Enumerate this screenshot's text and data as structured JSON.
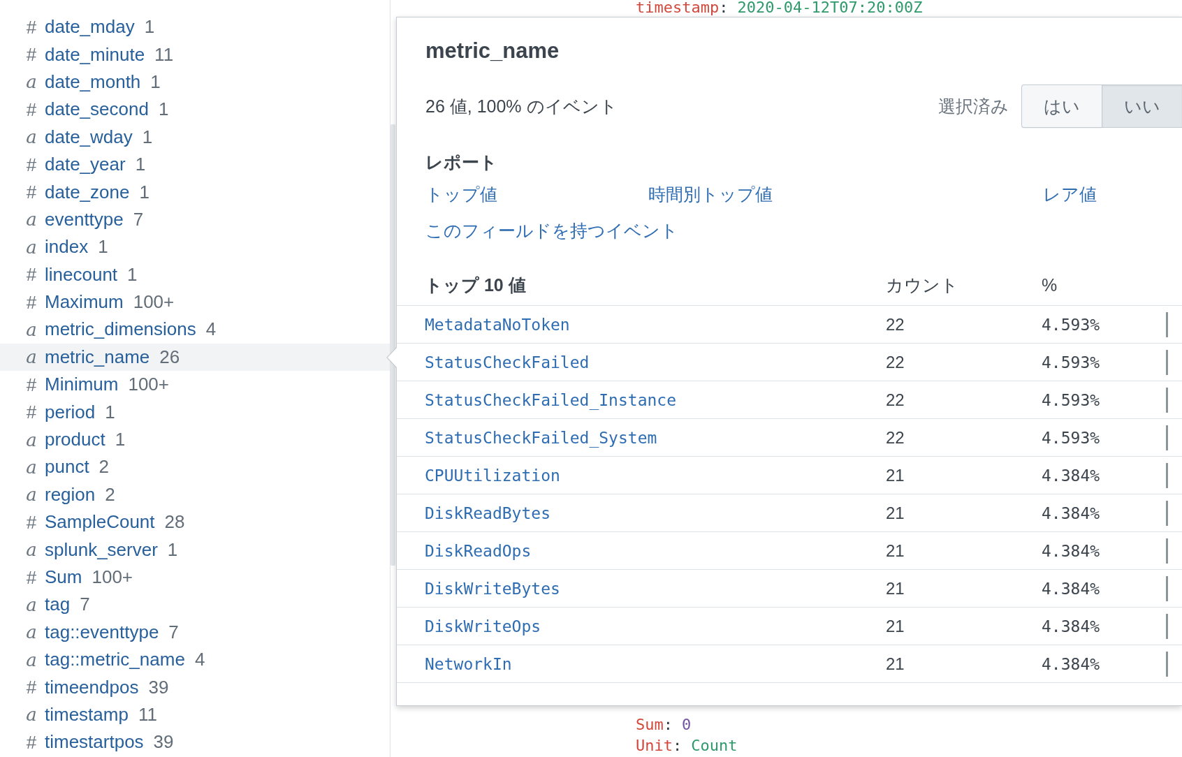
{
  "sidebar": {
    "fields": [
      {
        "kind": "number",
        "symbol": "#",
        "name": "date_mday",
        "count": "1",
        "selected": false
      },
      {
        "kind": "number",
        "symbol": "#",
        "name": "date_minute",
        "count": "11",
        "selected": false
      },
      {
        "kind": "string",
        "symbol": "a",
        "name": "date_month",
        "count": "1",
        "selected": false
      },
      {
        "kind": "number",
        "symbol": "#",
        "name": "date_second",
        "count": "1",
        "selected": false
      },
      {
        "kind": "string",
        "symbol": "a",
        "name": "date_wday",
        "count": "1",
        "selected": false
      },
      {
        "kind": "number",
        "symbol": "#",
        "name": "date_year",
        "count": "1",
        "selected": false
      },
      {
        "kind": "number",
        "symbol": "#",
        "name": "date_zone",
        "count": "1",
        "selected": false
      },
      {
        "kind": "string",
        "symbol": "a",
        "name": "eventtype",
        "count": "7",
        "selected": false
      },
      {
        "kind": "string",
        "symbol": "a",
        "name": "index",
        "count": "1",
        "selected": false
      },
      {
        "kind": "number",
        "symbol": "#",
        "name": "linecount",
        "count": "1",
        "selected": false
      },
      {
        "kind": "number",
        "symbol": "#",
        "name": "Maximum",
        "count": "100+",
        "selected": false
      },
      {
        "kind": "string",
        "symbol": "a",
        "name": "metric_dimensions",
        "count": "4",
        "selected": false
      },
      {
        "kind": "string",
        "symbol": "a",
        "name": "metric_name",
        "count": "26",
        "selected": true
      },
      {
        "kind": "number",
        "symbol": "#",
        "name": "Minimum",
        "count": "100+",
        "selected": false
      },
      {
        "kind": "number",
        "symbol": "#",
        "name": "period",
        "count": "1",
        "selected": false
      },
      {
        "kind": "string",
        "symbol": "a",
        "name": "product",
        "count": "1",
        "selected": false
      },
      {
        "kind": "string",
        "symbol": "a",
        "name": "punct",
        "count": "2",
        "selected": false
      },
      {
        "kind": "string",
        "symbol": "a",
        "name": "region",
        "count": "2",
        "selected": false
      },
      {
        "kind": "number",
        "symbol": "#",
        "name": "SampleCount",
        "count": "28",
        "selected": false
      },
      {
        "kind": "string",
        "symbol": "a",
        "name": "splunk_server",
        "count": "1",
        "selected": false
      },
      {
        "kind": "number",
        "symbol": "#",
        "name": "Sum",
        "count": "100+",
        "selected": false
      },
      {
        "kind": "string",
        "symbol": "a",
        "name": "tag",
        "count": "7",
        "selected": false
      },
      {
        "kind": "string",
        "symbol": "a",
        "name": "tag::eventtype",
        "count": "7",
        "selected": false
      },
      {
        "kind": "string",
        "symbol": "a",
        "name": "tag::metric_name",
        "count": "4",
        "selected": false
      },
      {
        "kind": "number",
        "symbol": "#",
        "name": "timeendpos",
        "count": "39",
        "selected": false
      },
      {
        "kind": "string",
        "symbol": "a",
        "name": "timestamp",
        "count": "11",
        "selected": false
      },
      {
        "kind": "number",
        "symbol": "#",
        "name": "timestartpos",
        "count": "39",
        "selected": false
      }
    ]
  },
  "event_text": {
    "top": [
      {
        "key": "timestamp",
        "delimiter": ":",
        "value": "2020-04-12T07:20:00Z",
        "kind": "string"
      }
    ],
    "bottom": [
      {
        "key": "Sum",
        "delimiter": ":",
        "value": "0",
        "kind": "number"
      },
      {
        "key": "Unit",
        "delimiter": ":",
        "value": "Count",
        "kind": "string"
      }
    ]
  },
  "popup": {
    "title": "metric_name",
    "summary": "26 値, 100% のイベント",
    "selected_label": "選択済み",
    "selected_options": [
      {
        "label": "はい",
        "selected": false
      },
      {
        "label": "いい",
        "selected": true
      }
    ],
    "reports_heading": "レポート",
    "report_links": [
      "トップ値",
      "時間別トップ値",
      "レア値",
      "このフィールドを持つイベント"
    ],
    "table": {
      "columns": [
        "トップ 10 値",
        "カウント",
        "%"
      ],
      "rows": [
        {
          "value": "MetadataNoToken",
          "count": "22",
          "percent": "4.593%"
        },
        {
          "value": "StatusCheckFailed",
          "count": "22",
          "percent": "4.593%"
        },
        {
          "value": "StatusCheckFailed_Instance",
          "count": "22",
          "percent": "4.593%"
        },
        {
          "value": "StatusCheckFailed_System",
          "count": "22",
          "percent": "4.593%"
        },
        {
          "value": "CPUUtilization",
          "count": "21",
          "percent": "4.384%"
        },
        {
          "value": "DiskReadBytes",
          "count": "21",
          "percent": "4.384%"
        },
        {
          "value": "DiskReadOps",
          "count": "21",
          "percent": "4.384%"
        },
        {
          "value": "DiskWriteBytes",
          "count": "21",
          "percent": "4.384%"
        },
        {
          "value": "DiskWriteOps",
          "count": "21",
          "percent": "4.384%"
        },
        {
          "value": "NetworkIn",
          "count": "21",
          "percent": "4.384%"
        }
      ]
    }
  }
}
